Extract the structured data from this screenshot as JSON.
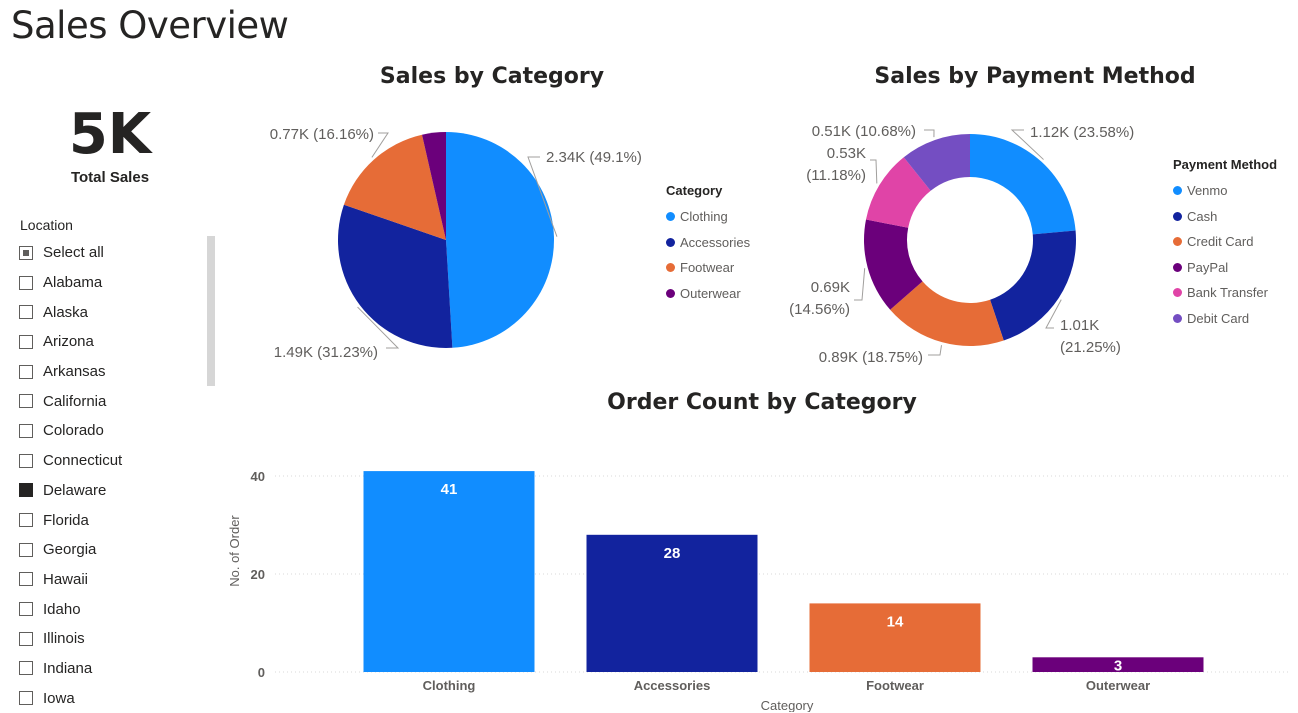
{
  "page": {
    "title": "Sales Overview"
  },
  "kpi": {
    "value": "5K",
    "label": "Total Sales"
  },
  "slicer": {
    "title": "Location",
    "items": [
      {
        "label": "Select all",
        "state": "partial"
      },
      {
        "label": "Alabama",
        "state": "unchecked"
      },
      {
        "label": "Alaska",
        "state": "unchecked"
      },
      {
        "label": "Arizona",
        "state": "unchecked"
      },
      {
        "label": "Arkansas",
        "state": "unchecked"
      },
      {
        "label": "California",
        "state": "unchecked"
      },
      {
        "label": "Colorado",
        "state": "unchecked"
      },
      {
        "label": "Connecticut",
        "state": "unchecked"
      },
      {
        "label": "Delaware",
        "state": "checked"
      },
      {
        "label": "Florida",
        "state": "unchecked"
      },
      {
        "label": "Georgia",
        "state": "unchecked"
      },
      {
        "label": "Hawaii",
        "state": "unchecked"
      },
      {
        "label": "Idaho",
        "state": "unchecked"
      },
      {
        "label": "Illinois",
        "state": "unchecked"
      },
      {
        "label": "Indiana",
        "state": "unchecked"
      },
      {
        "label": "Iowa",
        "state": "unchecked"
      }
    ]
  },
  "chart_data": [
    {
      "type": "pie",
      "title": "Sales by Category",
      "legend_title": "Category",
      "legend_position": "right",
      "slices": [
        {
          "name": "Clothing",
          "value": 2.34,
          "label": "2.34K (49.1%)",
          "color": "#118DFF"
        },
        {
          "name": "Accessories",
          "value": 1.49,
          "label": "1.49K (31.23%)",
          "color": "#12239E"
        },
        {
          "name": "Footwear",
          "value": 0.77,
          "label": "0.77K (16.16%)",
          "color": "#E66C37"
        },
        {
          "name": "Outerwear",
          "value": 0.17,
          "label": "",
          "color": "#6B007B"
        }
      ]
    },
    {
      "type": "donut",
      "title": "Sales by Payment Method",
      "legend_title": "Payment Method",
      "legend_position": "right",
      "slices": [
        {
          "name": "Venmo",
          "value": 1.12,
          "label": "1.12K (23.58%)",
          "color": "#118DFF"
        },
        {
          "name": "Cash",
          "value": 1.01,
          "label": "1.01K (21.25%)",
          "color": "#12239E"
        },
        {
          "name": "Credit Card",
          "value": 0.89,
          "label": "0.89K (18.75%)",
          "color": "#E66C37"
        },
        {
          "name": "PayPal",
          "value": 0.69,
          "label": "0.69K (14.56%)",
          "color": "#6B007B"
        },
        {
          "name": "Bank Transfer",
          "value": 0.53,
          "label": "0.53K (11.18%)",
          "color": "#E044A7"
        },
        {
          "name": "Debit Card",
          "value": 0.51,
          "label": "0.51K (10.68%)",
          "color": "#744EC2"
        }
      ]
    },
    {
      "type": "bar",
      "title": "Order Count by Category",
      "xlabel": "Category",
      "ylabel": "No. of Order",
      "ylim": [
        0,
        40
      ],
      "yticks": [
        0,
        20,
        40
      ],
      "grid": true,
      "categories": [
        "Clothing",
        "Accessories",
        "Footwear",
        "Outerwear"
      ],
      "values": [
        41,
        28,
        14,
        3
      ],
      "colors": [
        "#118DFF",
        "#12239E",
        "#E66C37",
        "#6B007B"
      ]
    }
  ]
}
